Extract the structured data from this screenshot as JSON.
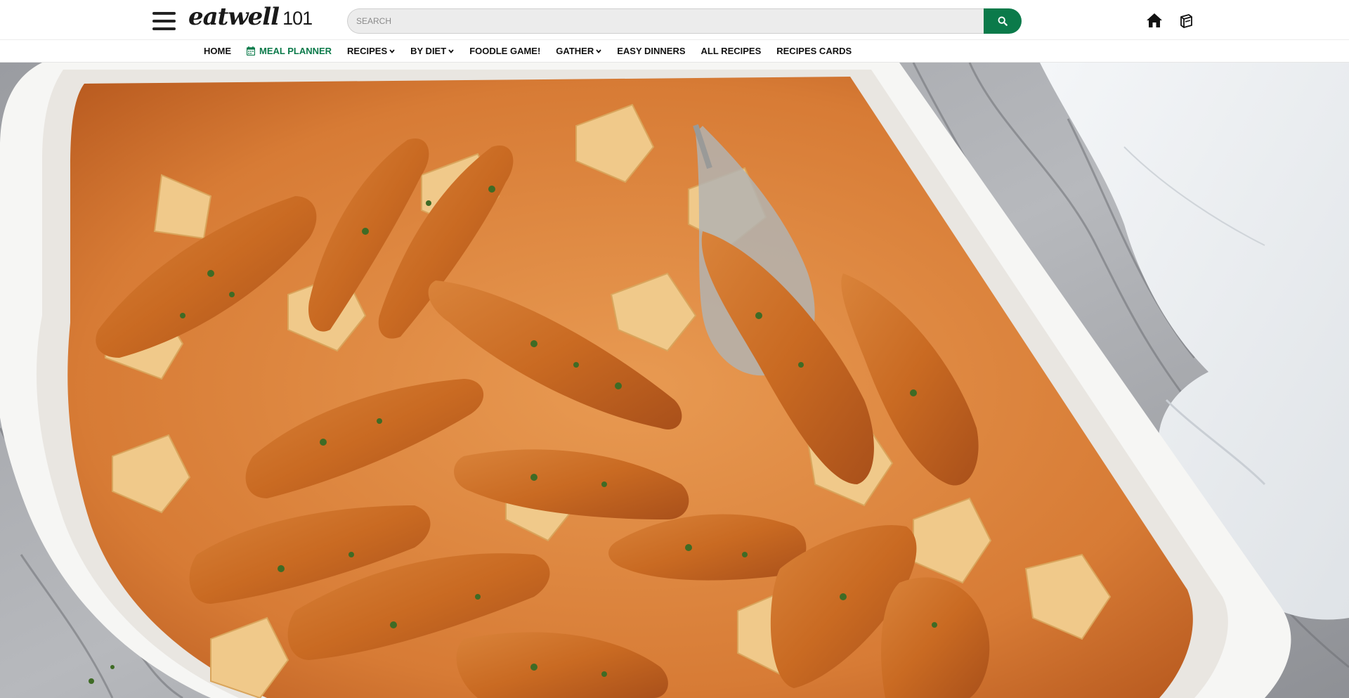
{
  "header": {
    "logo_word": "eatwell",
    "logo_number": "101",
    "search_placeholder": "SEARCH"
  },
  "nav": {
    "items": [
      {
        "label": "HOME",
        "dropdown": false
      },
      {
        "label": "MEAL PLANNER",
        "dropdown": false,
        "icon": "calendar-icon",
        "active": true
      },
      {
        "label": "RECIPES",
        "dropdown": true
      },
      {
        "label": "BY DIET",
        "dropdown": true
      },
      {
        "label": "FOODLE GAME!",
        "dropdown": false
      },
      {
        "label": "GATHER",
        "dropdown": true
      },
      {
        "label": "EASY DINNERS",
        "dropdown": false
      },
      {
        "label": "ALL RECIPES",
        "dropdown": false
      },
      {
        "label": "RECIPES CARDS",
        "dropdown": false
      }
    ]
  },
  "icons": {
    "menu": "hamburger-menu-icon",
    "search": "search-icon",
    "home": "home-icon",
    "recipe_box": "recipe-box-icon",
    "calendar": "calendar-icon",
    "caret": "chevron-down-icon"
  },
  "colors": {
    "brand_green": "#0b7a4a",
    "search_bg": "#ececec",
    "text_dark": "#111111"
  },
  "hero": {
    "subject": "baked chicken pieces over bow-tie pasta in a white baking dish on marble with a white napkin"
  }
}
